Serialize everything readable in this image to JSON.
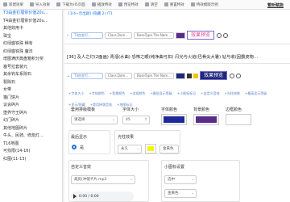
{
  "toolbar": {
    "items": [
      "新建效果",
      "导入效果",
      "下载为H5页面",
      "播放特效",
      "预览特效",
      "清空",
      "重置特效",
      "特效模版示例"
    ],
    "right_link": "繁昕赋能"
  },
  "sidebar": {
    "items": [
      "T3由金钉埋依价值20u...",
      "T4由金钉埋依价值20u...",
      "其他效用卡",
      "珠宝",
      "红绿盛铁珠 稀有",
      "红绿盛铁珠 魔法",
      "增图满庆典盘箱积分奖",
      "塞号拉套装元",
      "其余钩车系除石",
      "裂除石",
      "女带",
      "猫门饼片",
      "议会碎片",
      "堕界守王碎片",
      "幻门碎片",
      "其他地图碎片",
      "牛头、民骑、修炮灯...",
      "T16地图",
      "可找限(14-16)",
      "红图(11-13)"
    ],
    "active_index": 0
  },
  "main": {
    "breadcrumb": "[1/4~示出颜] (隐藏 2) /T1",
    "row1": {
      "pill1": "T4由金钉...",
      "pill2": "Class.Dom...",
      "pill3": "BaseType.The Nam...",
      "preview": "效果预览",
      "preview_color": "#e0409a",
      "preview_bg": "#ffffff"
    },
    "line2": "[36] 及人之灯(2面画) 青溜(水曲) 恐怖之眼(纯净曲弓扣) 闪光与火焰(巴骨尖大暑) 钻与收(因霸皮物...",
    "row3": {
      "pill1": "T4由金钉...",
      "pill2": "Class.Dom...",
      "pill3": "BaseType.The Nam...",
      "preview": "效果预览",
      "preview_color": "#ffffff",
      "preview_bg": "#1e2a7a"
    },
    "chips": [
      "+字体大小",
      "+字体颜色",
      "+背景颜色",
      "+边框颜色",
      "+最低显示等级",
      "+小图标标记",
      "+自定义音效",
      "+光柱效果",
      "+最高显示等级",
      "+显示/隐藏",
      "+禁用掉落音效",
      "+地图标记"
    ],
    "settings": {
      "font_template_label": "套用排版模板",
      "font_template_value": "请选择",
      "font_size_label": "字体大小",
      "font_size_value": "45",
      "font_color_label": "字体颜色",
      "font_color": "#1e2a9a",
      "bg_color_label": "背景颜色",
      "bg_color": "#5a2c8a",
      "border_color_label": "边框颜色",
      "border_color": "#ffffff"
    },
    "display": {
      "label": "最后显示",
      "option": "是"
    },
    "beam": {
      "label": "光柱效果",
      "mode": "永久",
      "color_label": "金黄色",
      "color": "#f5f500"
    },
    "sound": {
      "label": "自定义音效",
      "file": "裁剪(冲储卡片.mp3",
      "time": "0:00 / 0:00"
    },
    "minimap": {
      "label": "小图标设置",
      "size_value": "选中",
      "color_value": "金黄色"
    }
  }
}
